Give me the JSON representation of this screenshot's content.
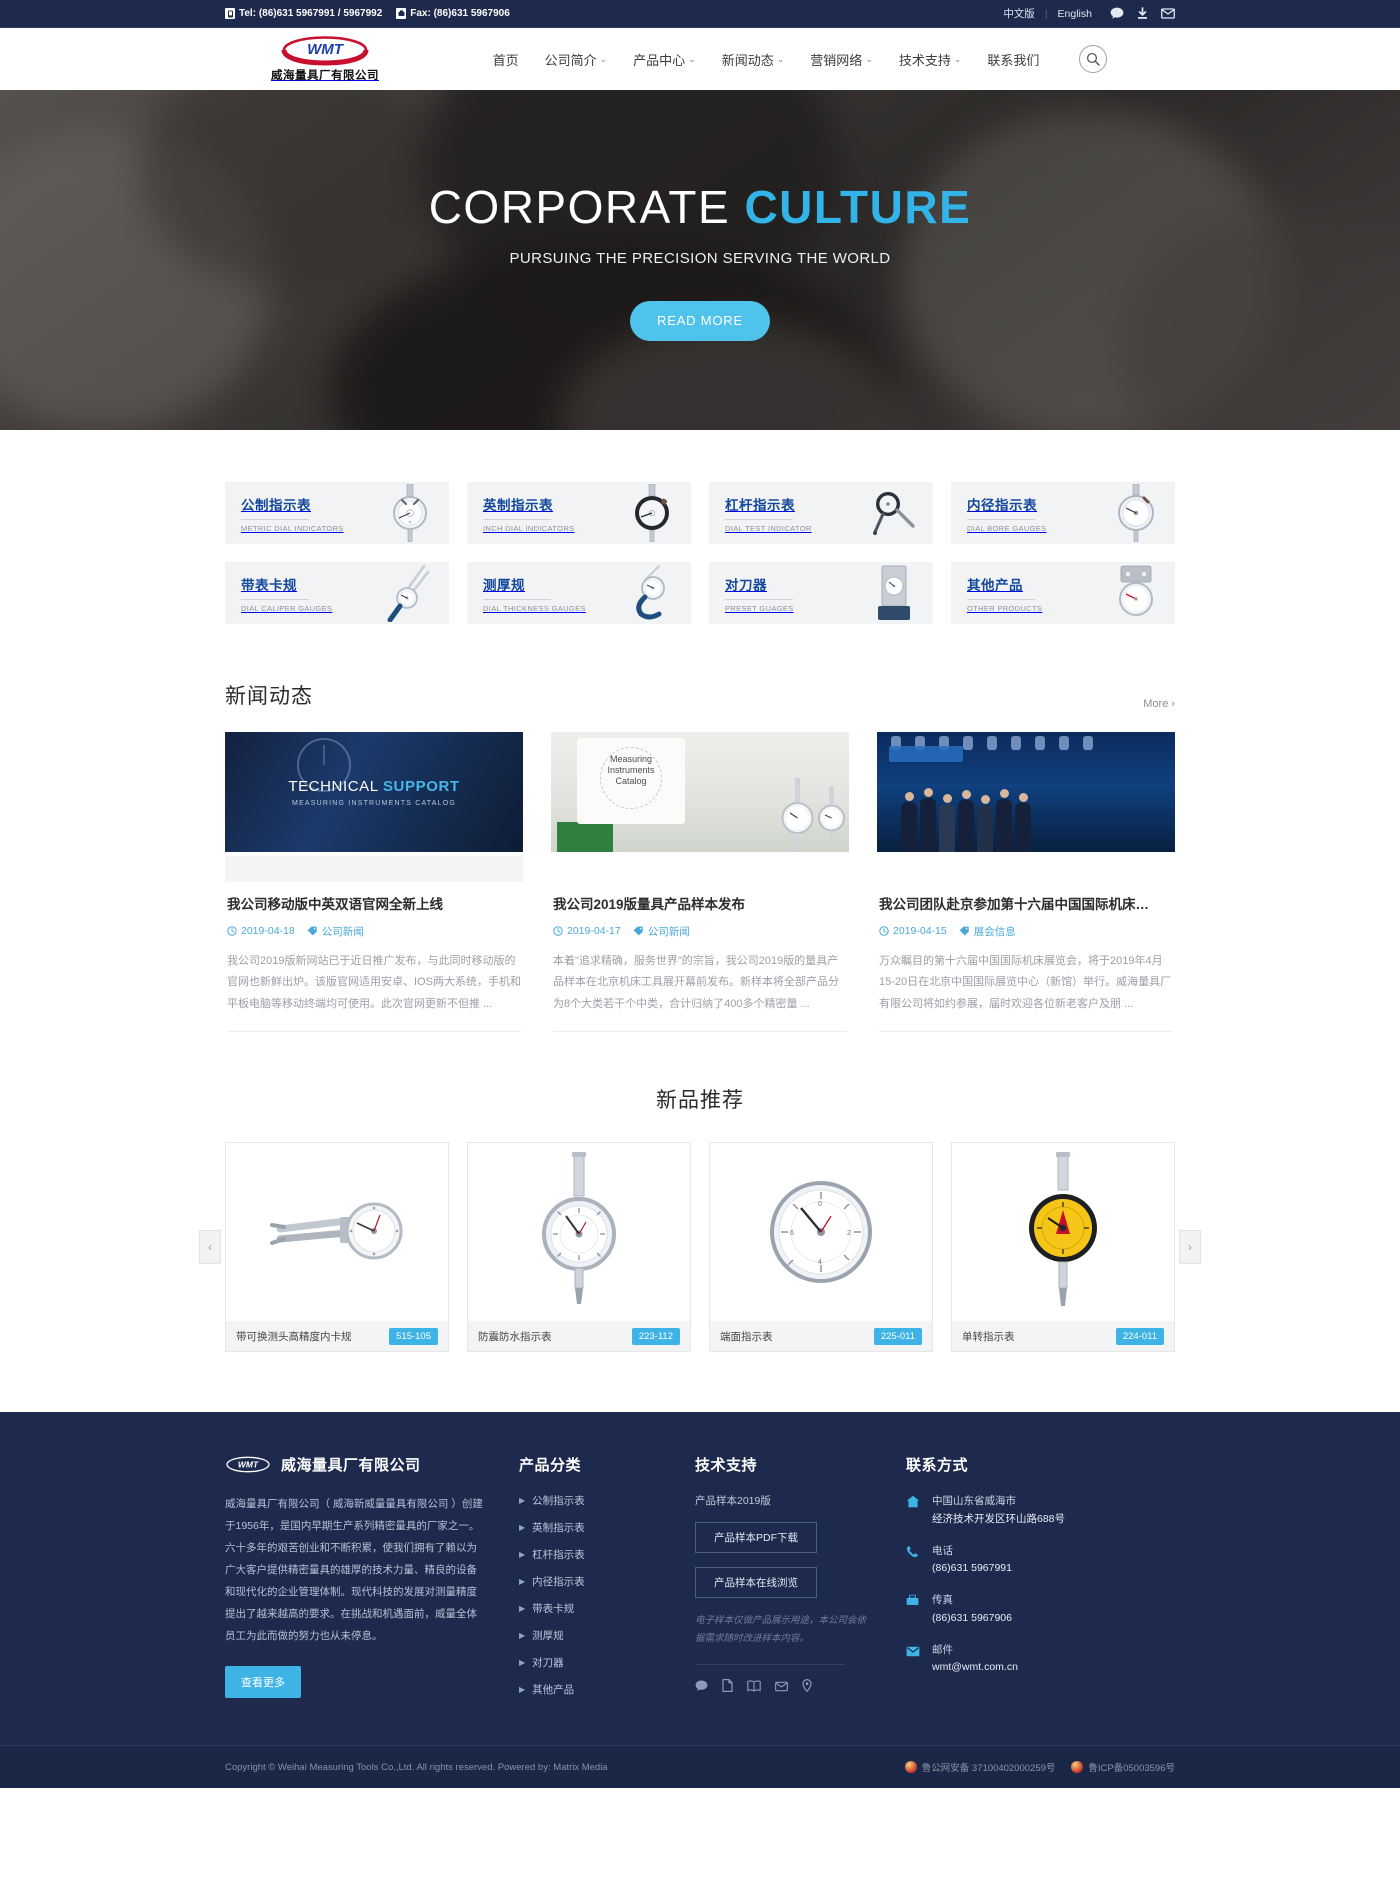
{
  "topbar": {
    "phone_icon": "phone-icon",
    "phone": "Tel: (86)631 5967991 / 5967992",
    "fax_icon": "fax-icon",
    "fax": "Fax: (86)631 5967906",
    "lang_cn": "中文版",
    "lang_sep": "|",
    "lang_en": "English",
    "icons": [
      "chat-icon",
      "download-icon",
      "mail-icon"
    ]
  },
  "header": {
    "logo_mark": "WMT",
    "logo_text": "威海量具厂有限公司",
    "nav": [
      {
        "label": "首页",
        "caret": false
      },
      {
        "label": "公司简介",
        "caret": true
      },
      {
        "label": "产品中心",
        "caret": true
      },
      {
        "label": "新闻动态",
        "caret": true
      },
      {
        "label": "营销网络",
        "caret": true
      },
      {
        "label": "技术支持",
        "caret": true
      },
      {
        "label": "联系我们",
        "caret": false
      }
    ],
    "search_icon": "search-icon"
  },
  "hero": {
    "title_light": "CORPORATE",
    "title_bold": "CULTURE",
    "subtitle": "PURSUING THE PRECISION SERVING THE WORLD",
    "button": "READ MORE",
    "accent": "#33b4e8"
  },
  "categories": [
    {
      "zh": "公制指示表",
      "en": "METRIC DIAL INDICATORS",
      "icon": "dial-indicator-icon"
    },
    {
      "zh": "英制指示表",
      "en": "INCH DIAL INDICATORS",
      "icon": "dial-indicator-dark-icon"
    },
    {
      "zh": "杠杆指示表",
      "en": "DIAL TEST INDICATOR",
      "icon": "dial-test-indicator-icon"
    },
    {
      "zh": "内径指示表",
      "en": "DIAL BORE GAUGES",
      "icon": "bore-gauge-icon"
    },
    {
      "zh": "带表卡规",
      "en": "DIAL CALIPER GAUGES",
      "icon": "caliper-gauge-icon"
    },
    {
      "zh": "测厚规",
      "en": "DIAL THICKNESS GAUGES",
      "icon": "thickness-gauge-icon"
    },
    {
      "zh": "对刀器",
      "en": "PRESET GUAGES",
      "icon": "preset-gauge-icon"
    },
    {
      "zh": "其他产品",
      "en": "OTHER PRODUCTS",
      "icon": "other-product-icon"
    }
  ],
  "news": {
    "title": "新闻动态",
    "more": "More",
    "items": [
      {
        "thumb_title_a": "TECHNICAL",
        "thumb_title_b": "SUPPORT",
        "thumb_sub": "MEASURING INSTRUMENTS CATALOG",
        "title": "我公司移动版中英双语官网全新上线",
        "date": "2019-04-18",
        "tag": "公司新闻",
        "desc": "我公司2019版新网站已于近日推广发布，与此同时移动版的官网也新鲜出炉。该版官网适用安卓、IOS两大系统，手机和平板电脑等移动终端均可使用。此次官网更新不但推 ..."
      },
      {
        "poster_l1": "Measuring",
        "poster_l2": "Instruments",
        "poster_l3": "Catalog",
        "title": "我公司2019版量具产品样本发布",
        "date": "2019-04-17",
        "tag": "公司新闻",
        "desc": "本着\"追求精确，服务世界\"的宗旨，我公司2019版的量具产品样本在北京机床工具展开幕前发布。新样本将全部产品分为8个大类若干个中类，合计归纳了400多个精密量 ..."
      },
      {
        "title": "我公司团队赴京参加第十六届中国国际机床…",
        "date": "2019-04-15",
        "tag": "展会信息",
        "desc": "万众瞩目的第十六届中国国际机床展览会，将于2019年4月15-20日在北京中国国际展览中心（新馆）举行。威海量具厂有限公司将如约参展，届时欢迎各位新老客户及朋 ..."
      }
    ]
  },
  "products": {
    "title": "新品推荐",
    "prev_icon": "chevron-left-icon",
    "next_icon": "chevron-right-icon",
    "items": [
      {
        "name": "带可换测头高精度内卡规",
        "code": "515-105",
        "icon": "inside-caliper-icon"
      },
      {
        "name": "防震防水指示表",
        "code": "223-112",
        "icon": "waterproof-dial-icon"
      },
      {
        "name": "端面指示表",
        "code": "225-011",
        "icon": "face-dial-icon"
      },
      {
        "name": "单转指示表",
        "code": "224-011",
        "icon": "single-rev-dial-icon"
      }
    ]
  },
  "footer": {
    "brand_logo": "WMT",
    "brand_name": "威海量具厂有限公司",
    "about": "威海量具厂有限公司（ 威海新威量量具有限公司 ）创建于1956年，是国内早期生产系列精密量具的厂家之一。六十多年的艰苦创业和不断积累，使我们拥有了赖以为广大客户提供精密量具的雄厚的技术力量、精良的设备和现代化的企业管理体制。现代科技的发展对测量精度提出了越来越高的要求。在挑战和机遇面前，威量全体员工为此而做的努力也从未停息。",
    "more_button": "查看更多",
    "cat_title": "产品分类",
    "cat_items": [
      "公制指示表",
      "英制指示表",
      "杠杆指示表",
      "内径指示表",
      "带表卡规",
      "测厚规",
      "对刀器",
      "其他产品"
    ],
    "support_title": "技术支持",
    "support_sub": "产品样本2019版",
    "support_btn1": "产品样本PDF下载",
    "support_btn2": "产品样本在线浏览",
    "support_note": "电子样本仅做产品展示用途，本公司会依据需求随时改进样本内容。",
    "support_icons": [
      "chat-icon",
      "pdf-icon",
      "book-icon",
      "mail-icon",
      "location-icon"
    ],
    "contact_title": "联系方式",
    "contact": [
      {
        "icon": "home-icon",
        "label": "中国山东省威海市",
        "value": "经济技术开发区环山路688号"
      },
      {
        "icon": "phone-icon",
        "label": "电话",
        "value": "(86)631 5967991"
      },
      {
        "icon": "fax-icon",
        "label": "传真",
        "value": "(86)631 5967906"
      },
      {
        "icon": "mail-icon",
        "label": "邮件",
        "value": "wmt@wmt.com.cn"
      }
    ],
    "copyright": "Copyright © Weihai Measuring Tools Co.,Ltd. All rights reserved. Powered by: Matrix Media",
    "gongan": "鲁公网安备 37100402000259号",
    "icp": "鲁ICP备05003596号"
  }
}
